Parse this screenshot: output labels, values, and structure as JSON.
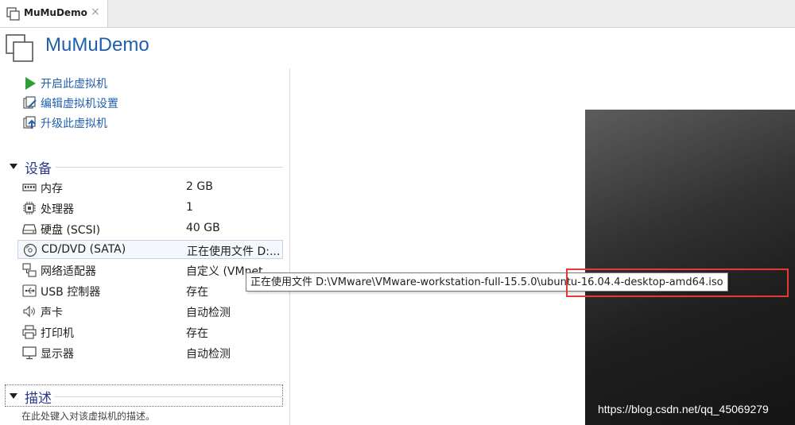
{
  "tab": {
    "label": "MuMuDemo",
    "close": "×"
  },
  "header": {
    "title": "MuMuDemo"
  },
  "actions": [
    {
      "label": "开启此虚拟机",
      "icon": "play-icon"
    },
    {
      "label": "编辑虚拟机设置",
      "icon": "edit-settings-icon"
    },
    {
      "label": "升级此虚拟机",
      "icon": "upgrade-icon"
    }
  ],
  "devices_section": {
    "title": "设备"
  },
  "devices": [
    {
      "name": "内存",
      "value": "2 GB",
      "icon": "memory-icon"
    },
    {
      "name": "处理器",
      "value": "1",
      "icon": "processor-icon"
    },
    {
      "name": "硬盘 (SCSI)",
      "value": "40 GB",
      "icon": "hard-disk-icon"
    },
    {
      "name": "CD/DVD (SATA)",
      "value": "正在使用文件 D:...",
      "icon": "cd-dvd-icon",
      "selected": true
    },
    {
      "name": "网络适配器",
      "value": "自定义 (VMnet",
      "icon": "network-adapter-icon"
    },
    {
      "name": "USB 控制器",
      "value": "存在",
      "icon": "usb-icon"
    },
    {
      "name": "声卡",
      "value": "自动检测",
      "icon": "sound-card-icon"
    },
    {
      "name": "打印机",
      "value": "存在",
      "icon": "printer-icon"
    },
    {
      "name": "显示器",
      "value": "自动检测",
      "icon": "display-icon"
    }
  ],
  "description_section": {
    "title": "描述",
    "placeholder": "在此处键入对该虚拟机的描述。"
  },
  "tooltip": {
    "text": "正在使用文件 D:\\VMware\\VMware-workstation-full-15.5.0\\ubuntu-16.04.4-desktop-amd64.iso"
  },
  "watermark": "https://blog.csdn.net/qq_45069279",
  "colors": {
    "accent": "#1f5fad",
    "section_title": "#2c3a87",
    "highlight": "#e53935",
    "play": "#2e9e3a"
  }
}
